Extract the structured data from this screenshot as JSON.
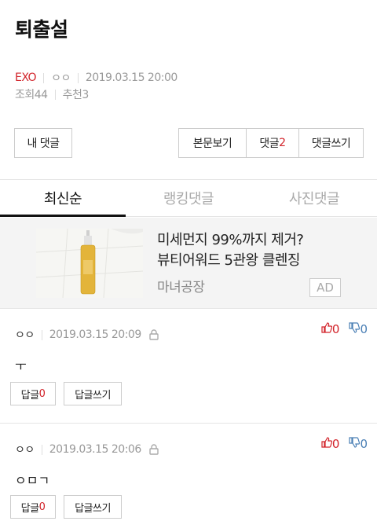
{
  "post": {
    "title": "퇴출설",
    "category": "EXO",
    "author": "ㅇㅇ",
    "datetime": "2019.03.15 20:00",
    "views": "조회44",
    "recommend": "추천3"
  },
  "buttons": {
    "my_comments": "내 댓글",
    "view_body": "본문보기",
    "comments_label": "댓글",
    "comments_count": "2",
    "write_comment": "댓글쓰기"
  },
  "tabs": [
    "최신순",
    "랭킹댓글",
    "사진댓글"
  ],
  "ad": {
    "line1": "미세먼지 99%까지 제거?",
    "line2": "뷰티어워드 5관왕 클렌징",
    "brand": "마녀공장",
    "tag": "AD"
  },
  "comments": [
    {
      "author": "ㅇㅇ",
      "datetime": "2019.03.15 20:09",
      "text": "ㅜ",
      "up": "0",
      "down": "0",
      "reply_label": "답글",
      "reply_count": "0",
      "write_reply": "답글쓰기"
    },
    {
      "author": "ㅇㅇ",
      "datetime": "2019.03.15 20:06",
      "text": "ㅇㅁㄱ",
      "up": "0",
      "down": "0",
      "reply_label": "답글",
      "reply_count": "0",
      "write_reply": "답글쓰기"
    }
  ],
  "colors": {
    "accent_red": "#d2232a",
    "downvote_blue": "#4a7fb5"
  },
  "icons": [
    "lock-icon",
    "thumbs-up-icon",
    "thumbs-down-icon"
  ]
}
